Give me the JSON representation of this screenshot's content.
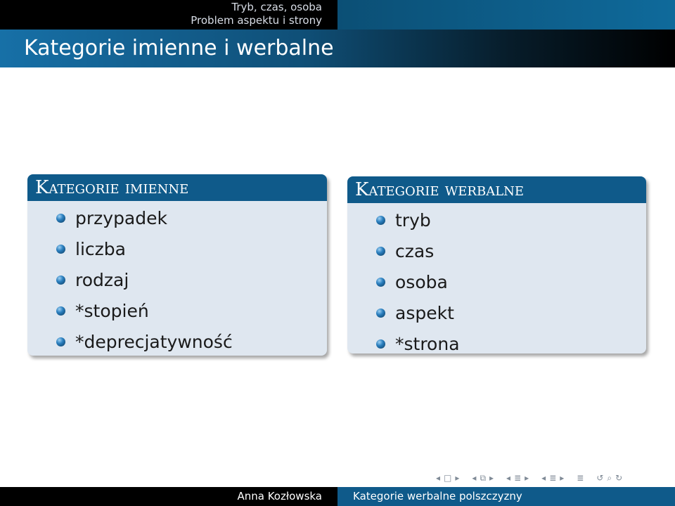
{
  "header": {
    "section": "Tryb, czas, osoba",
    "subsection": "Problem aspektu i strony"
  },
  "frame": {
    "title": "Kategorie imienne i werbalne"
  },
  "blocks": [
    {
      "title": "Kategorie imienne",
      "items": [
        "przypadek",
        "liczba",
        "rodzaj",
        "*stopień",
        "*deprecjatywność"
      ]
    },
    {
      "title": "Kategorie werbalne",
      "items": [
        "tryb",
        "czas",
        "osoba",
        "aspekt",
        "*strona"
      ]
    }
  ],
  "navigation": {
    "icons": [
      "nav-prev-slide-icon",
      "nav-slide-icon",
      "nav-next-slide-icon",
      "nav-prev-frame-icon",
      "nav-frame-icon",
      "nav-next-frame-icon",
      "nav-prev-subsection-icon",
      "nav-subsection-icon",
      "nav-next-subsection-icon",
      "nav-prev-section-icon",
      "nav-section-icon",
      "nav-next-section-icon",
      "nav-appendix-icon",
      "nav-back-icon",
      "nav-search-icon",
      "nav-forward-icon"
    ]
  },
  "footer": {
    "author": "Anna Kozłowska",
    "talk_title": "Kategorie werbalne polszczyzny"
  },
  "colors": {
    "block_header": "#0f5a8a",
    "block_body": "#dfe7f0",
    "title_bar_start": "#1770a7",
    "footer_right": "#0f5a8a"
  }
}
